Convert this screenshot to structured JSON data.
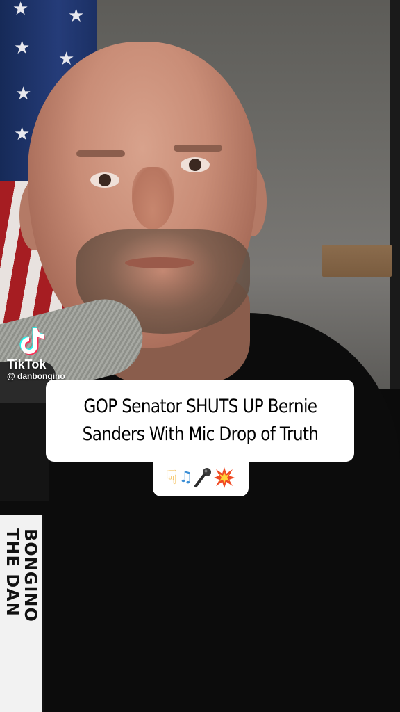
{
  "watermark": {
    "brand": "TikTok",
    "handle": "@ danbongino"
  },
  "caption": {
    "line1": "GOP Senator SHUTS UP Bernie",
    "line2": "Sanders With Mic Drop of Truth",
    "emojis": [
      "hand-pointing-down-icon",
      "musical-notes-icon",
      "microphone-icon",
      "collision-icon"
    ]
  },
  "book_spine": {
    "line1": "THE DAN",
    "line2": "BONGINO"
  },
  "colors": {
    "caption_bg": "#ffffff",
    "caption_text": "#000000",
    "background": "#0b0b0b"
  }
}
